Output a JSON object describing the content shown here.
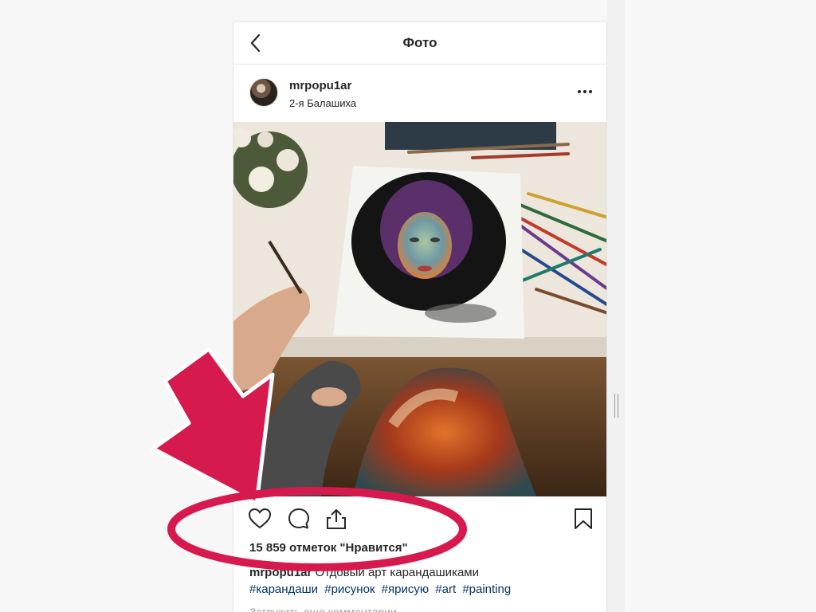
{
  "topbar": {
    "title": "Фото"
  },
  "post": {
    "username": "mrpopu1ar",
    "location": "2-я Балашиха",
    "likes_text": "15 859 отметок \"Нравится\"",
    "caption_user": "mrpopu1ar",
    "caption_text": "Отдовый арт карандашиками",
    "hashtags": [
      "#карандаши",
      "#рисунок",
      "#ярисую",
      "#art",
      "#painting"
    ],
    "load_more_comments": "Загрузить еще комментарии"
  },
  "icons": {
    "back": "chevron-left-icon",
    "more": "more-dots-icon",
    "like": "heart-icon",
    "comment": "comment-bubble-icon",
    "share": "share-icon",
    "save": "bookmark-icon"
  },
  "colors": {
    "annotation": "#d61a4e",
    "hashtag": "#003569"
  }
}
